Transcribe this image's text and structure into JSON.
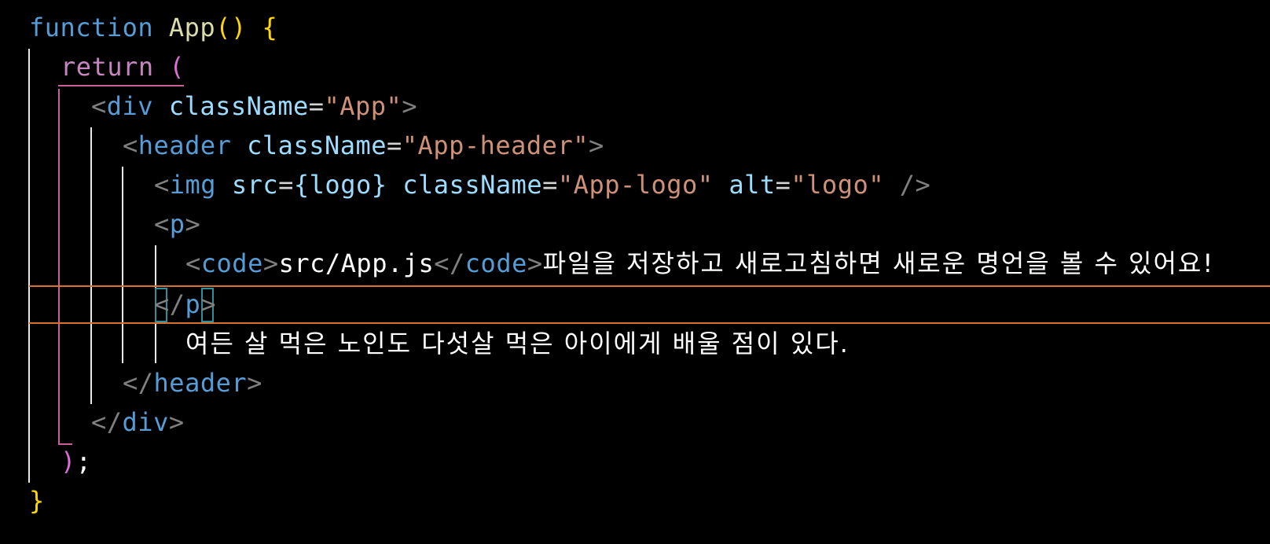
{
  "editor": {
    "colors": {
      "background": "#000000",
      "keyword": "#569cd6",
      "function_name": "#dcdcaa",
      "bracket_level1": "#ffd700",
      "bracket_level2": "#da70d6",
      "tag_bracket": "#808080",
      "tag_name": "#569cd6",
      "attribute": "#9cdcfe",
      "string": "#ce9178",
      "current_line_border": "#d6712d",
      "bracket_match_border": "#2a8f9e"
    },
    "lines": [
      {
        "t1": "function",
        "t2": " ",
        "t3": "App",
        "t4": "()",
        "t5": " {"
      },
      {
        "t1": "return",
        "t2": " ("
      },
      {
        "t1": "<",
        "t2": "div",
        "t3": " className",
        "t4": "=",
        "t5": "\"App\"",
        "t6": ">"
      },
      {
        "t1": "<",
        "t2": "header",
        "t3": " className",
        "t4": "=",
        "t5": "\"App-header\"",
        "t6": ">"
      },
      {
        "t1": "<",
        "t2": "img",
        "t3": " src",
        "t4": "=",
        "t5": "{logo}",
        "t6": " className",
        "t7": "=",
        "t8": "\"App-logo\"",
        "t9": " alt",
        "t10": "=",
        "t11": "\"logo\"",
        "t12": " />"
      },
      {
        "t1": "<",
        "t2": "p",
        "t3": ">"
      },
      {
        "t1": "<",
        "t2": "code",
        "t3": ">",
        "t4": "src/App.js",
        "t5": "</",
        "t6": "code",
        "t7": ">",
        "t8": "파일을 저장하고 새로고침하면 새로운 명언을 볼 수 있어요!"
      },
      {
        "t1": "<",
        "t2": "/",
        "t3": "p",
        "t4": ">"
      },
      {
        "t1": "여든 살 먹은 노인도 다섯살 먹은 아이에게 배울 점이 있다."
      },
      {
        "t1": "</",
        "t2": "header",
        "t3": ">"
      },
      {
        "t1": "</",
        "t2": "div",
        "t3": ">"
      },
      {
        "t1": ")",
        "t2": ";"
      },
      {
        "t1": "}"
      }
    ]
  }
}
